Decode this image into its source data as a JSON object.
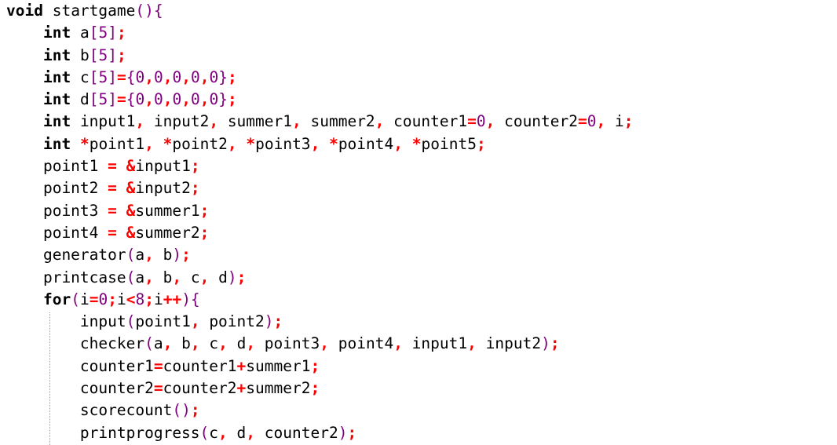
{
  "editor": {
    "lines": [
      [
        {
          "t": "void",
          "c": "kw"
        },
        {
          "t": " startgame",
          "c": "ident"
        },
        {
          "t": "(){",
          "c": "br"
        }
      ],
      [
        {
          "t": "    ",
          "c": "ident"
        },
        {
          "t": "int",
          "c": "kw"
        },
        {
          "t": " a",
          "c": "ident"
        },
        {
          "t": "[",
          "c": "br"
        },
        {
          "t": "5",
          "c": "num"
        },
        {
          "t": "]",
          "c": "br"
        },
        {
          "t": ";",
          "c": "op"
        }
      ],
      [
        {
          "t": "    ",
          "c": "ident"
        },
        {
          "t": "int",
          "c": "kw"
        },
        {
          "t": " b",
          "c": "ident"
        },
        {
          "t": "[",
          "c": "br"
        },
        {
          "t": "5",
          "c": "num"
        },
        {
          "t": "]",
          "c": "br"
        },
        {
          "t": ";",
          "c": "op"
        }
      ],
      [
        {
          "t": "    ",
          "c": "ident"
        },
        {
          "t": "int",
          "c": "kw"
        },
        {
          "t": " c",
          "c": "ident"
        },
        {
          "t": "[",
          "c": "br"
        },
        {
          "t": "5",
          "c": "num"
        },
        {
          "t": "]",
          "c": "br"
        },
        {
          "t": "=",
          "c": "op"
        },
        {
          "t": "{",
          "c": "br"
        },
        {
          "t": "0",
          "c": "num"
        },
        {
          "t": ",",
          "c": "op"
        },
        {
          "t": "0",
          "c": "num"
        },
        {
          "t": ",",
          "c": "op"
        },
        {
          "t": "0",
          "c": "num"
        },
        {
          "t": ",",
          "c": "op"
        },
        {
          "t": "0",
          "c": "num"
        },
        {
          "t": ",",
          "c": "op"
        },
        {
          "t": "0",
          "c": "num"
        },
        {
          "t": "}",
          "c": "br"
        },
        {
          "t": ";",
          "c": "op"
        }
      ],
      [
        {
          "t": "    ",
          "c": "ident"
        },
        {
          "t": "int",
          "c": "kw"
        },
        {
          "t": " d",
          "c": "ident"
        },
        {
          "t": "[",
          "c": "br"
        },
        {
          "t": "5",
          "c": "num"
        },
        {
          "t": "]",
          "c": "br"
        },
        {
          "t": "=",
          "c": "op"
        },
        {
          "t": "{",
          "c": "br"
        },
        {
          "t": "0",
          "c": "num"
        },
        {
          "t": ",",
          "c": "op"
        },
        {
          "t": "0",
          "c": "num"
        },
        {
          "t": ",",
          "c": "op"
        },
        {
          "t": "0",
          "c": "num"
        },
        {
          "t": ",",
          "c": "op"
        },
        {
          "t": "0",
          "c": "num"
        },
        {
          "t": ",",
          "c": "op"
        },
        {
          "t": "0",
          "c": "num"
        },
        {
          "t": "}",
          "c": "br"
        },
        {
          "t": ";",
          "c": "op"
        }
      ],
      [
        {
          "t": "    ",
          "c": "ident"
        },
        {
          "t": "int",
          "c": "kw"
        },
        {
          "t": " input1",
          "c": "ident"
        },
        {
          "t": ",",
          "c": "op"
        },
        {
          "t": " input2",
          "c": "ident"
        },
        {
          "t": ",",
          "c": "op"
        },
        {
          "t": " summer1",
          "c": "ident"
        },
        {
          "t": ",",
          "c": "op"
        },
        {
          "t": " summer2",
          "c": "ident"
        },
        {
          "t": ",",
          "c": "op"
        },
        {
          "t": " counter1",
          "c": "ident"
        },
        {
          "t": "=",
          "c": "op"
        },
        {
          "t": "0",
          "c": "num"
        },
        {
          "t": ",",
          "c": "op"
        },
        {
          "t": " counter2",
          "c": "ident"
        },
        {
          "t": "=",
          "c": "op"
        },
        {
          "t": "0",
          "c": "num"
        },
        {
          "t": ",",
          "c": "op"
        },
        {
          "t": " i",
          "c": "ident"
        },
        {
          "t": ";",
          "c": "op"
        }
      ],
      [
        {
          "t": "    ",
          "c": "ident"
        },
        {
          "t": "int",
          "c": "kw"
        },
        {
          "t": " ",
          "c": "ident"
        },
        {
          "t": "*",
          "c": "op"
        },
        {
          "t": "point1",
          "c": "ident"
        },
        {
          "t": ",",
          "c": "op"
        },
        {
          "t": " ",
          "c": "ident"
        },
        {
          "t": "*",
          "c": "op"
        },
        {
          "t": "point2",
          "c": "ident"
        },
        {
          "t": ",",
          "c": "op"
        },
        {
          "t": " ",
          "c": "ident"
        },
        {
          "t": "*",
          "c": "op"
        },
        {
          "t": "point3",
          "c": "ident"
        },
        {
          "t": ",",
          "c": "op"
        },
        {
          "t": " ",
          "c": "ident"
        },
        {
          "t": "*",
          "c": "op"
        },
        {
          "t": "point4",
          "c": "ident"
        },
        {
          "t": ",",
          "c": "op"
        },
        {
          "t": " ",
          "c": "ident"
        },
        {
          "t": "*",
          "c": "op"
        },
        {
          "t": "point5",
          "c": "ident"
        },
        {
          "t": ";",
          "c": "op"
        }
      ],
      [
        {
          "t": "    point1 ",
          "c": "ident"
        },
        {
          "t": "=",
          "c": "op"
        },
        {
          "t": " ",
          "c": "ident"
        },
        {
          "t": "&",
          "c": "op"
        },
        {
          "t": "input1",
          "c": "ident"
        },
        {
          "t": ";",
          "c": "op"
        }
      ],
      [
        {
          "t": "    point2 ",
          "c": "ident"
        },
        {
          "t": "=",
          "c": "op"
        },
        {
          "t": " ",
          "c": "ident"
        },
        {
          "t": "&",
          "c": "op"
        },
        {
          "t": "input2",
          "c": "ident"
        },
        {
          "t": ";",
          "c": "op"
        }
      ],
      [
        {
          "t": "    point3 ",
          "c": "ident"
        },
        {
          "t": "=",
          "c": "op"
        },
        {
          "t": " ",
          "c": "ident"
        },
        {
          "t": "&",
          "c": "op"
        },
        {
          "t": "summer1",
          "c": "ident"
        },
        {
          "t": ";",
          "c": "op"
        }
      ],
      [
        {
          "t": "    point4 ",
          "c": "ident"
        },
        {
          "t": "=",
          "c": "op"
        },
        {
          "t": " ",
          "c": "ident"
        },
        {
          "t": "&",
          "c": "op"
        },
        {
          "t": "summer2",
          "c": "ident"
        },
        {
          "t": ";",
          "c": "op"
        }
      ],
      [
        {
          "t": "    generator",
          "c": "ident"
        },
        {
          "t": "(",
          "c": "br"
        },
        {
          "t": "a",
          "c": "ident"
        },
        {
          "t": ",",
          "c": "op"
        },
        {
          "t": " b",
          "c": "ident"
        },
        {
          "t": ")",
          "c": "br"
        },
        {
          "t": ";",
          "c": "op"
        }
      ],
      [
        {
          "t": "    printcase",
          "c": "ident"
        },
        {
          "t": "(",
          "c": "br"
        },
        {
          "t": "a",
          "c": "ident"
        },
        {
          "t": ",",
          "c": "op"
        },
        {
          "t": " b",
          "c": "ident"
        },
        {
          "t": ",",
          "c": "op"
        },
        {
          "t": " c",
          "c": "ident"
        },
        {
          "t": ",",
          "c": "op"
        },
        {
          "t": " d",
          "c": "ident"
        },
        {
          "t": ")",
          "c": "br"
        },
        {
          "t": ";",
          "c": "op"
        }
      ],
      [
        {
          "t": "    ",
          "c": "ident"
        },
        {
          "t": "for",
          "c": "kw"
        },
        {
          "t": "(",
          "c": "br"
        },
        {
          "t": "i",
          "c": "ident"
        },
        {
          "t": "=",
          "c": "op"
        },
        {
          "t": "0",
          "c": "num"
        },
        {
          "t": ";",
          "c": "op"
        },
        {
          "t": "i",
          "c": "ident"
        },
        {
          "t": "<",
          "c": "op"
        },
        {
          "t": "8",
          "c": "num"
        },
        {
          "t": ";",
          "c": "op"
        },
        {
          "t": "i",
          "c": "ident"
        },
        {
          "t": "++",
          "c": "op"
        },
        {
          "t": "){",
          "c": "br"
        }
      ],
      [
        {
          "t": "        input",
          "c": "ident"
        },
        {
          "t": "(",
          "c": "br"
        },
        {
          "t": "point1",
          "c": "ident"
        },
        {
          "t": ",",
          "c": "op"
        },
        {
          "t": " point2",
          "c": "ident"
        },
        {
          "t": ")",
          "c": "br"
        },
        {
          "t": ";",
          "c": "op"
        }
      ],
      [
        {
          "t": "        checker",
          "c": "ident"
        },
        {
          "t": "(",
          "c": "br"
        },
        {
          "t": "a",
          "c": "ident"
        },
        {
          "t": ",",
          "c": "op"
        },
        {
          "t": " b",
          "c": "ident"
        },
        {
          "t": ",",
          "c": "op"
        },
        {
          "t": " c",
          "c": "ident"
        },
        {
          "t": ",",
          "c": "op"
        },
        {
          "t": " d",
          "c": "ident"
        },
        {
          "t": ",",
          "c": "op"
        },
        {
          "t": " point3",
          "c": "ident"
        },
        {
          "t": ",",
          "c": "op"
        },
        {
          "t": " point4",
          "c": "ident"
        },
        {
          "t": ",",
          "c": "op"
        },
        {
          "t": " input1",
          "c": "ident"
        },
        {
          "t": ",",
          "c": "op"
        },
        {
          "t": " input2",
          "c": "ident"
        },
        {
          "t": ")",
          "c": "br"
        },
        {
          "t": ";",
          "c": "op"
        }
      ],
      [
        {
          "t": "        counter1",
          "c": "ident"
        },
        {
          "t": "=",
          "c": "op"
        },
        {
          "t": "counter1",
          "c": "ident"
        },
        {
          "t": "+",
          "c": "op"
        },
        {
          "t": "summer1",
          "c": "ident"
        },
        {
          "t": ";",
          "c": "op"
        }
      ],
      [
        {
          "t": "        counter2",
          "c": "ident"
        },
        {
          "t": "=",
          "c": "op"
        },
        {
          "t": "counter2",
          "c": "ident"
        },
        {
          "t": "+",
          "c": "op"
        },
        {
          "t": "summer2",
          "c": "ident"
        },
        {
          "t": ";",
          "c": "op"
        }
      ],
      [
        {
          "t": "        scorecount",
          "c": "ident"
        },
        {
          "t": "()",
          "c": "br"
        },
        {
          "t": ";",
          "c": "op"
        }
      ],
      [
        {
          "t": "        printprogress",
          "c": "ident"
        },
        {
          "t": "(",
          "c": "br"
        },
        {
          "t": "c",
          "c": "ident"
        },
        {
          "t": ",",
          "c": "op"
        },
        {
          "t": " d",
          "c": "ident"
        },
        {
          "t": ",",
          "c": "op"
        },
        {
          "t": " counter2",
          "c": "ident"
        },
        {
          "t": ")",
          "c": "br"
        },
        {
          "t": ";",
          "c": "op"
        }
      ]
    ]
  },
  "colors": {
    "background": "#ffffff",
    "text": "#000000",
    "operator": "#ff0000",
    "number_and_bracket": "#800080",
    "indent_guide": "#9a9a9a"
  }
}
